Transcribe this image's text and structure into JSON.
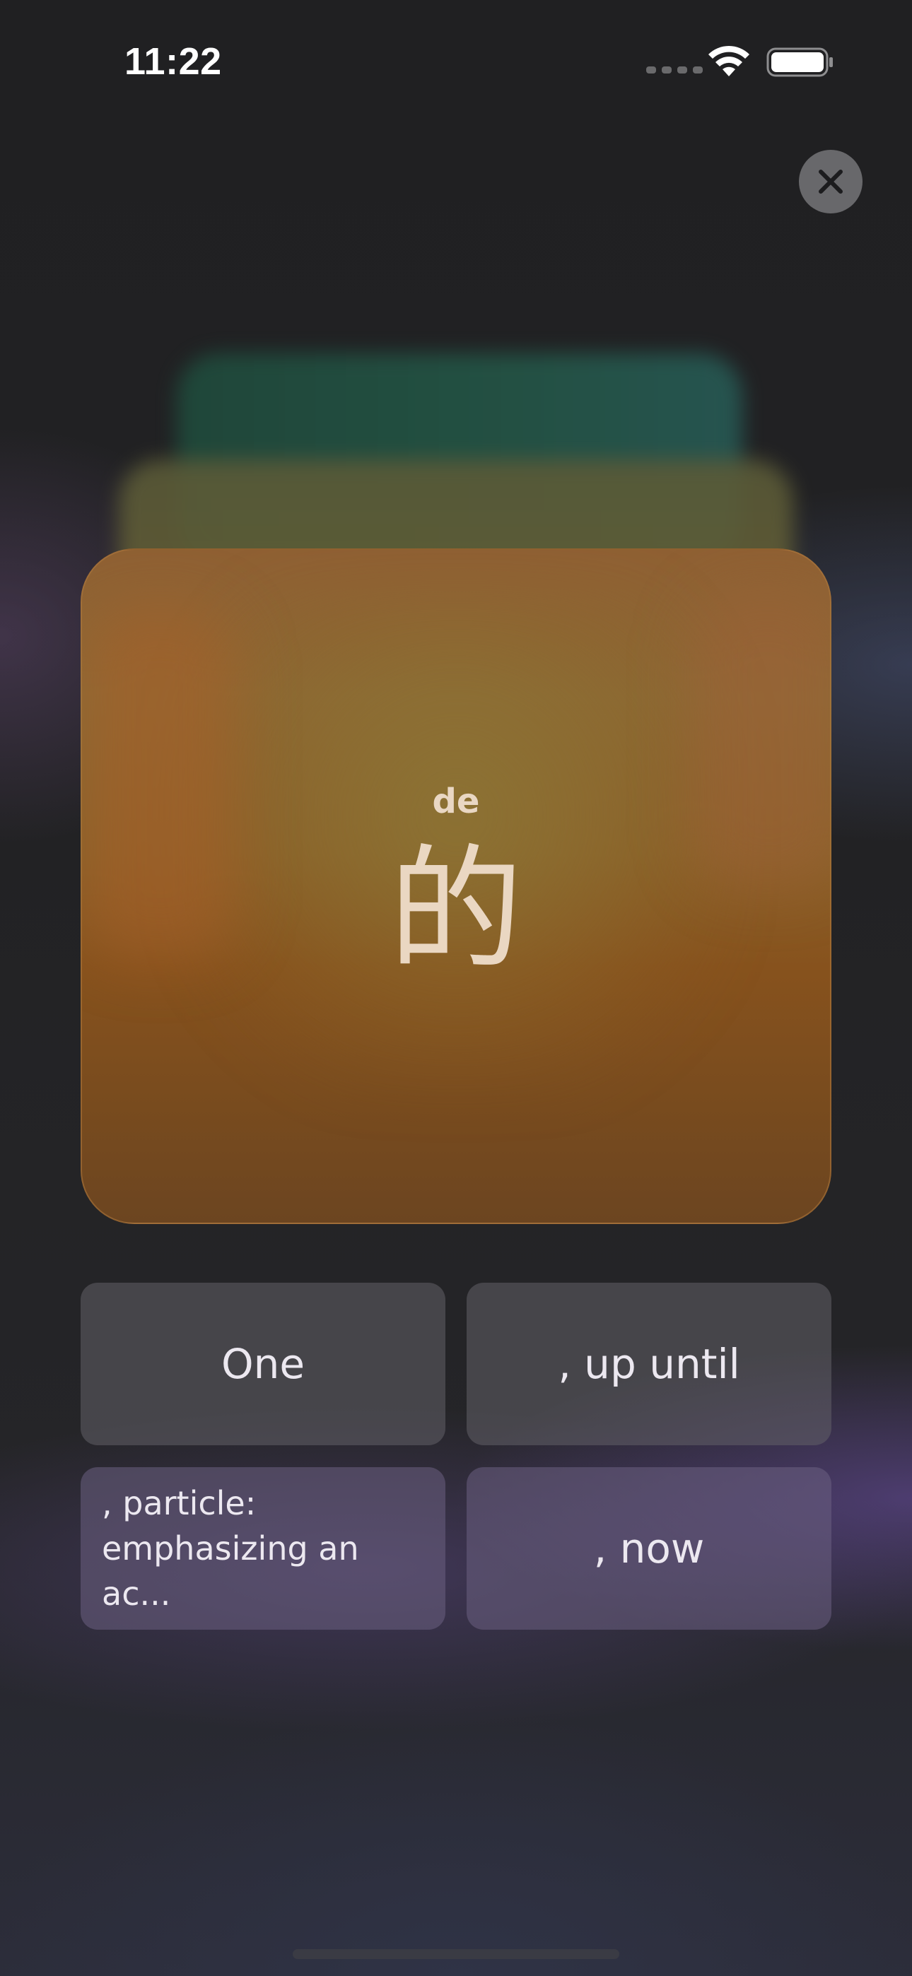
{
  "status_bar": {
    "time": "11:22"
  },
  "icons": {
    "close": "close-icon",
    "wifi": "wifi-icon",
    "battery": "battery-icon",
    "signal": "cellular-signal-icon"
  },
  "card": {
    "pinyin": "de",
    "character": "的",
    "accent_color": "#8b5a28"
  },
  "options": [
    {
      "label": "One"
    },
    {
      "label": ", up until"
    },
    {
      "label": ", particle: emphasizing an ac..."
    },
    {
      "label": ", now"
    }
  ]
}
